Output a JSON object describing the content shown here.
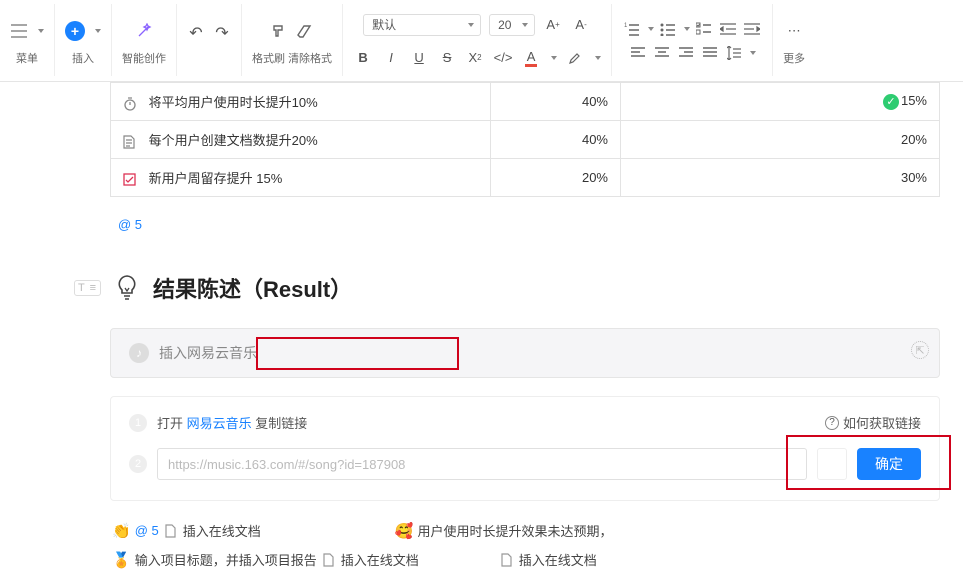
{
  "toolbar": {
    "group_menu_label": "菜单",
    "group_insert_label": "插入",
    "group_ai_label": "智能创作",
    "undo_tooltip": "撤销",
    "redo_tooltip": "重做",
    "format_brush_label": "格式刷",
    "clear_format_label": "清除格式",
    "font_style_select": "默认",
    "font_size_select": "20",
    "more_label": "更多"
  },
  "table_rows": [
    {
      "icon": "stopwatch-icon",
      "name": "将平均用户使用时长提升10%",
      "v1": "40%",
      "v2": "15%",
      "check": true
    },
    {
      "icon": "doc-icon",
      "name": "每个用户创建文档数提升20%",
      "v1": "40%",
      "v2": "20%"
    },
    {
      "icon": "checkbox-icon",
      "name": "新用户周留存提升 15%",
      "v1": "20%",
      "v2": "30%"
    }
  ],
  "mention_line": "@ 5",
  "heading": "结果陈述（Result）",
  "embed_title": "插入网易云音乐",
  "panel": {
    "open_prefix": "打开",
    "open_link_text": "网易云音乐",
    "open_suffix": "复制链接",
    "help_text": "如何获取链接",
    "url_placeholder": "https://music.163.com/#/song?id=187908",
    "confirm_label": "确定"
  },
  "suggestions": {
    "s1_at": "@ 5",
    "s1_text": "插入在线文档",
    "s2_text": "用户使用时长提升效果未达预期，",
    "s3_text": "输入项目标题，并插入项目报告",
    "s3_doc_text": "插入在线文档",
    "s4_text": "插入在线文档"
  }
}
